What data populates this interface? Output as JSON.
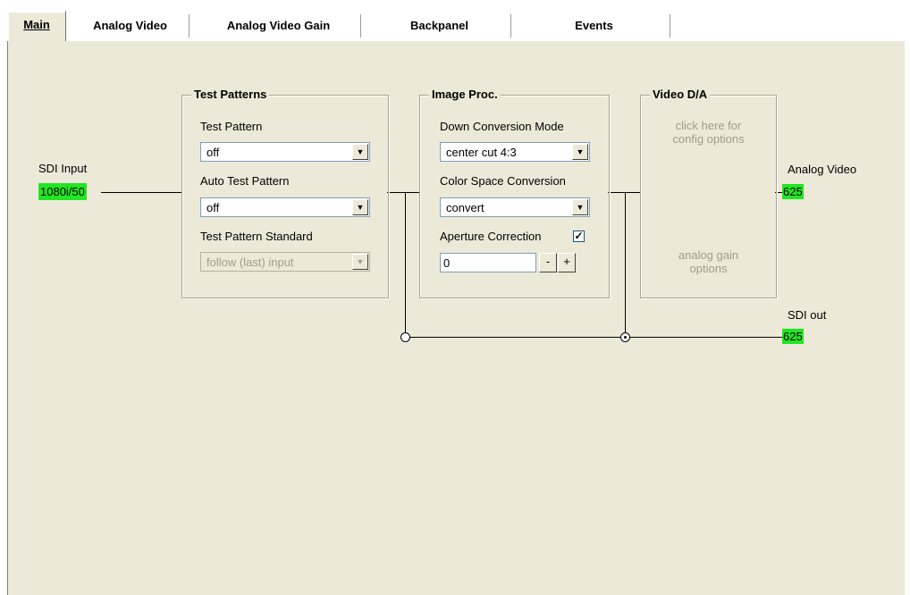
{
  "tabs": [
    {
      "label": "Main",
      "active": true
    },
    {
      "label": "Analog Video",
      "active": false
    },
    {
      "label": "Analog Video Gain",
      "active": false
    },
    {
      "label": "Backpanel",
      "active": false
    },
    {
      "label": "Events",
      "active": false
    }
  ],
  "input": {
    "label": "SDI Input",
    "value": "1080i/50"
  },
  "test_patterns": {
    "title": "Test Patterns",
    "pattern_label": "Test Pattern",
    "pattern_value": "off",
    "auto_label": "Auto Test Pattern",
    "auto_value": "off",
    "standard_label": "Test Pattern Standard",
    "standard_value": "follow (last) input"
  },
  "image_proc": {
    "title": "Image Proc.",
    "down_label": "Down Conversion Mode",
    "down_value": "center cut 4:3",
    "csc_label": "Color Space Conversion",
    "csc_value": "convert",
    "aperture_label": "Aperture Correction",
    "aperture_checked": "✓",
    "aperture_value": "0",
    "minus": "-",
    "plus": "+"
  },
  "video_da": {
    "title": "Video D/A",
    "config_text": "click here for config options",
    "gain_text": "analog gain options"
  },
  "outputs": {
    "analog_label": "Analog Video",
    "analog_value": "625",
    "sdi_label": "SDI out",
    "sdi_value": "625"
  },
  "colors": {
    "badge": "#22e622",
    "panel": "#ece9d8"
  }
}
